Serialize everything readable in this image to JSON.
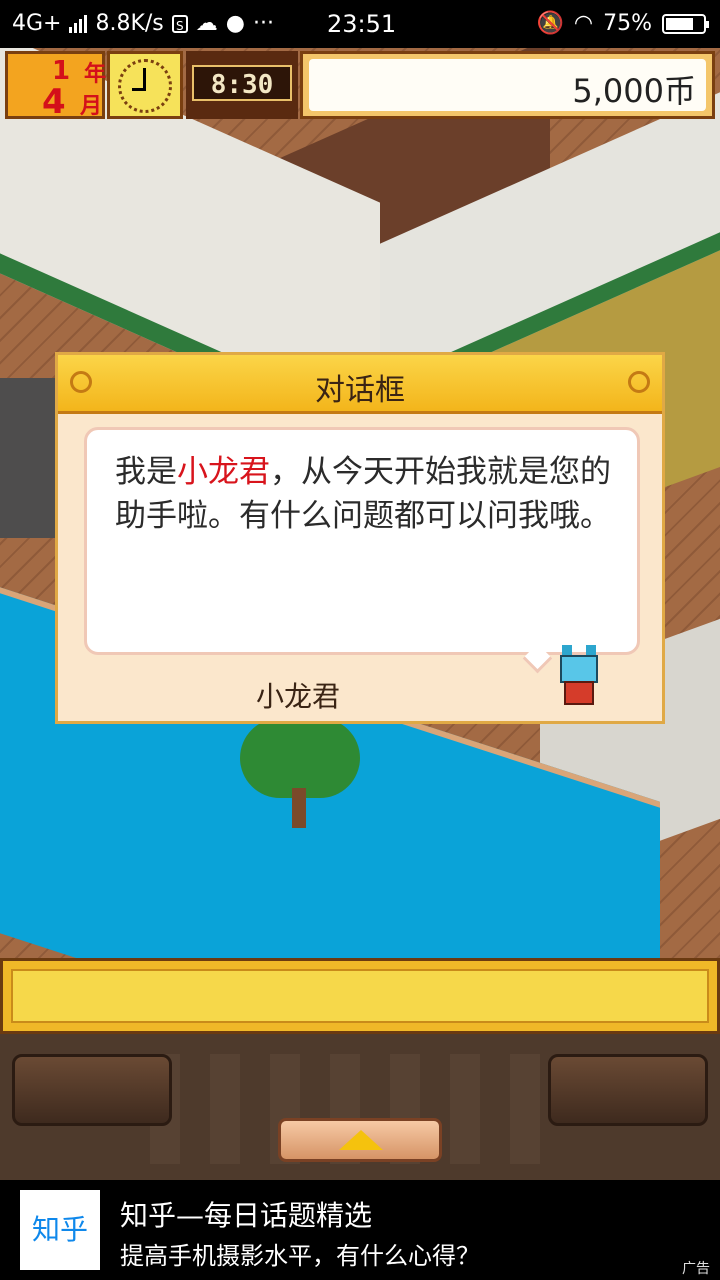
{
  "status_bar": {
    "network": "4G+",
    "speed": "8.8K/s",
    "sim_icon": "S",
    "time": "23:51",
    "battery": "75%",
    "battery_level": 0.75,
    "icons": [
      "signal-icon",
      "cloud-icon",
      "chat-icon",
      "more-icon",
      "mute-icon",
      "wifi-icon",
      "battery-icon"
    ]
  },
  "hud": {
    "year_num": "1",
    "year_unit": "年",
    "month_num": "4",
    "month_unit": "月",
    "time": "8:30",
    "money": "5,000币"
  },
  "dialog": {
    "title": "对话框",
    "message_before": "我是",
    "message_highlight": "小龙君",
    "message_after": "，从今天开始我就是您的助手啦。有什么问题都可以问我哦。",
    "speaker": "小龙君",
    "highlight_color": "#d8141c"
  },
  "ad": {
    "logo": "知乎",
    "title": "知乎—每日话题精选",
    "subtitle": "提高手机摄影水平，有什么心得？",
    "tag": "广告"
  }
}
